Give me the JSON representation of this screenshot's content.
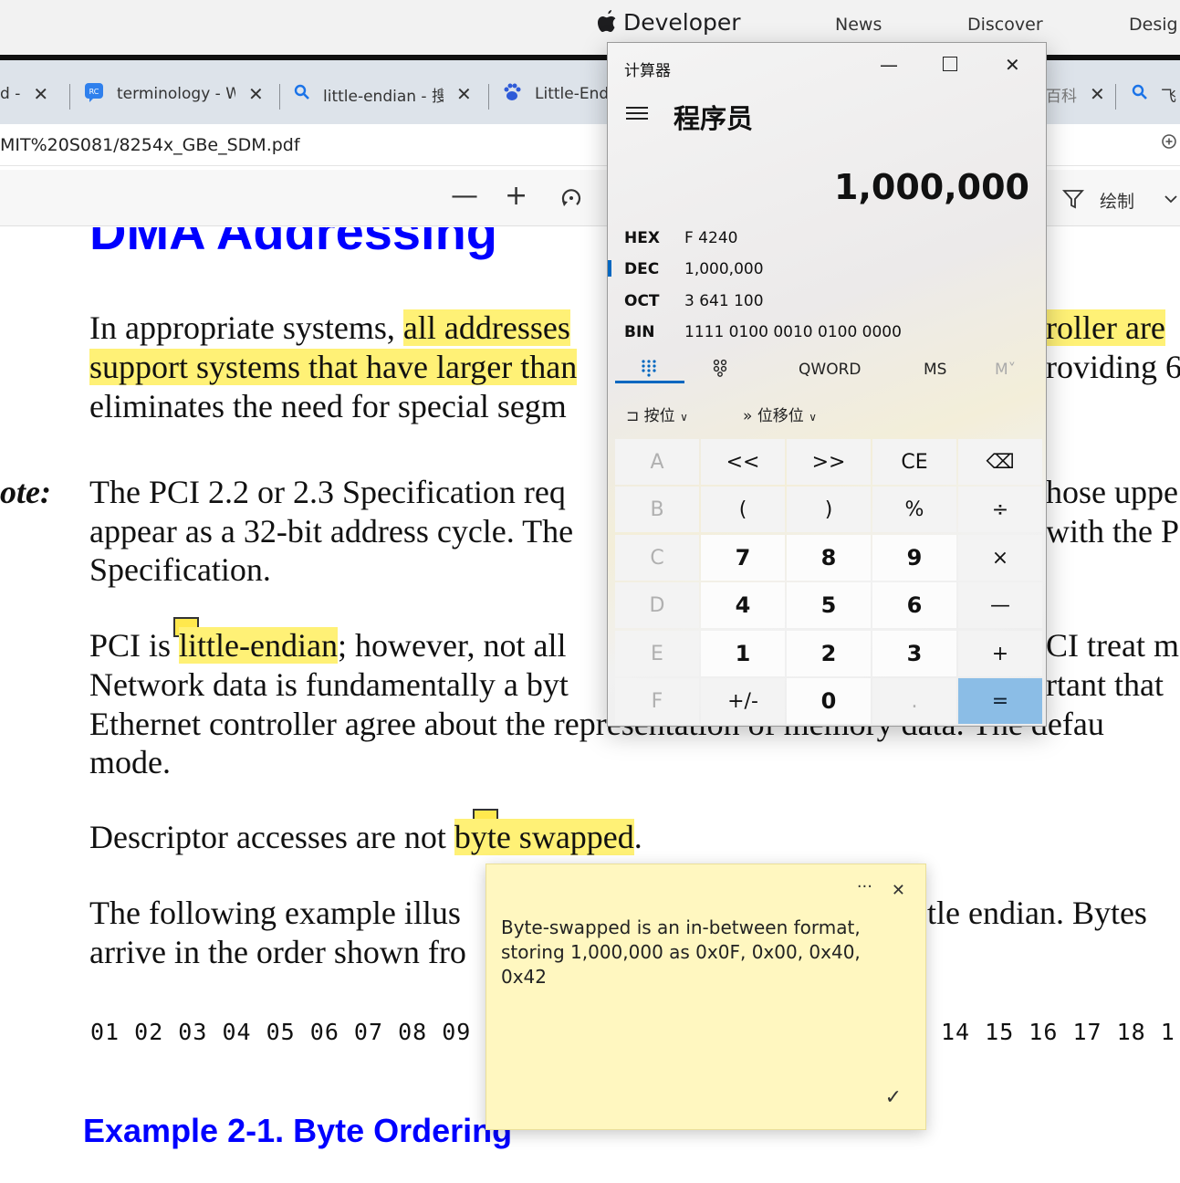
{
  "apple_bar": {
    "brand": "Developer",
    "nav": [
      "News",
      "Discover",
      "Desig"
    ]
  },
  "tabs": [
    {
      "label": "d - ",
      "icon": ""
    },
    {
      "label": "terminology - W",
      "icon": "rc-icon"
    },
    {
      "label": "little-endian - 搜",
      "icon": "search-icon"
    },
    {
      "label": "Little-End",
      "icon": "baidu-paw-icon"
    },
    {
      "label": "百科",
      "icon": ""
    },
    {
      "label": "飞",
      "icon": "search-icon"
    }
  ],
  "address": {
    "url": "MIT%20S081/8254x_GBe_SDM.pdf"
  },
  "pdf_toolbar": {
    "minus": "—",
    "plus": "+",
    "draw_label": "绘制"
  },
  "document": {
    "heading_top": "DMA Addressing",
    "p1": {
      "l1a": "In appropriate systems, ",
      "l1b": "all addresses",
      "l1c": "roller are",
      "l2a": "support systems that have larger than",
      "l2b": "roviding 6",
      "l3a": "eliminates the need for special segm"
    },
    "note_label": "ote:",
    "p2": {
      "l1a": "The PCI 2.2 or 2.3 Specification req",
      "l1b": "hose uppe",
      "l2a": "appear as a 32-bit address cycle. The",
      "l2b": "with the P",
      "l3": "Specification."
    },
    "p3": {
      "l1a": "PCI is ",
      "l1b": "little-endian",
      "l1c": "; however, not all",
      "l1d": "CI treat me",
      "l2a": "Network data is fundamentally a byt",
      "l2b": "rtant that",
      "l3": "Ethernet controller agree about the representation of memory data. The defau",
      "l4": "mode."
    },
    "p4": {
      "a": "Descriptor accesses are not ",
      "b": "byte swapped",
      "c": "."
    },
    "p5": {
      "l1a": "The following example illus",
      "l1b": "tle endian. Bytes",
      "l2a": "arrive in the order shown fro"
    },
    "bytes_left": "01 02 03 04 05 06 07 08 09",
    "bytes_right": "14 15 16 17 18 1",
    "heading_bottom": "Example 2-1. Byte Ordering"
  },
  "calculator": {
    "title": "计算器",
    "mode": "程序员",
    "display": "1,000,000",
    "radix": [
      {
        "name": "HEX",
        "value": "F 4240"
      },
      {
        "name": "DEC",
        "value": "1,000,000"
      },
      {
        "name": "OCT",
        "value": "3 641 100"
      },
      {
        "name": "BIN",
        "value": "1111 0100 0010 0100 0000"
      }
    ],
    "word_size": "QWORD",
    "ms": "MS",
    "mplus": "M˅",
    "bitwise": "按位",
    "bitshift": "位移位",
    "keys": [
      [
        "A",
        "<<",
        ">>",
        "CE",
        "⌫"
      ],
      [
        "B",
        "(",
        ")",
        "%",
        "÷"
      ],
      [
        "C",
        "7",
        "8",
        "9",
        "×"
      ],
      [
        "D",
        "4",
        "5",
        "6",
        "—"
      ],
      [
        "E",
        "1",
        "2",
        "3",
        "+"
      ],
      [
        "F",
        "+/-",
        "0",
        ".",
        "="
      ]
    ]
  },
  "sticky_note": {
    "text": "Byte-swapped is an in-between format, storing 1,000,000 as 0x0F, 0x00, 0x40, 0x42",
    "more": "···",
    "close": "✕",
    "check": "✓"
  }
}
